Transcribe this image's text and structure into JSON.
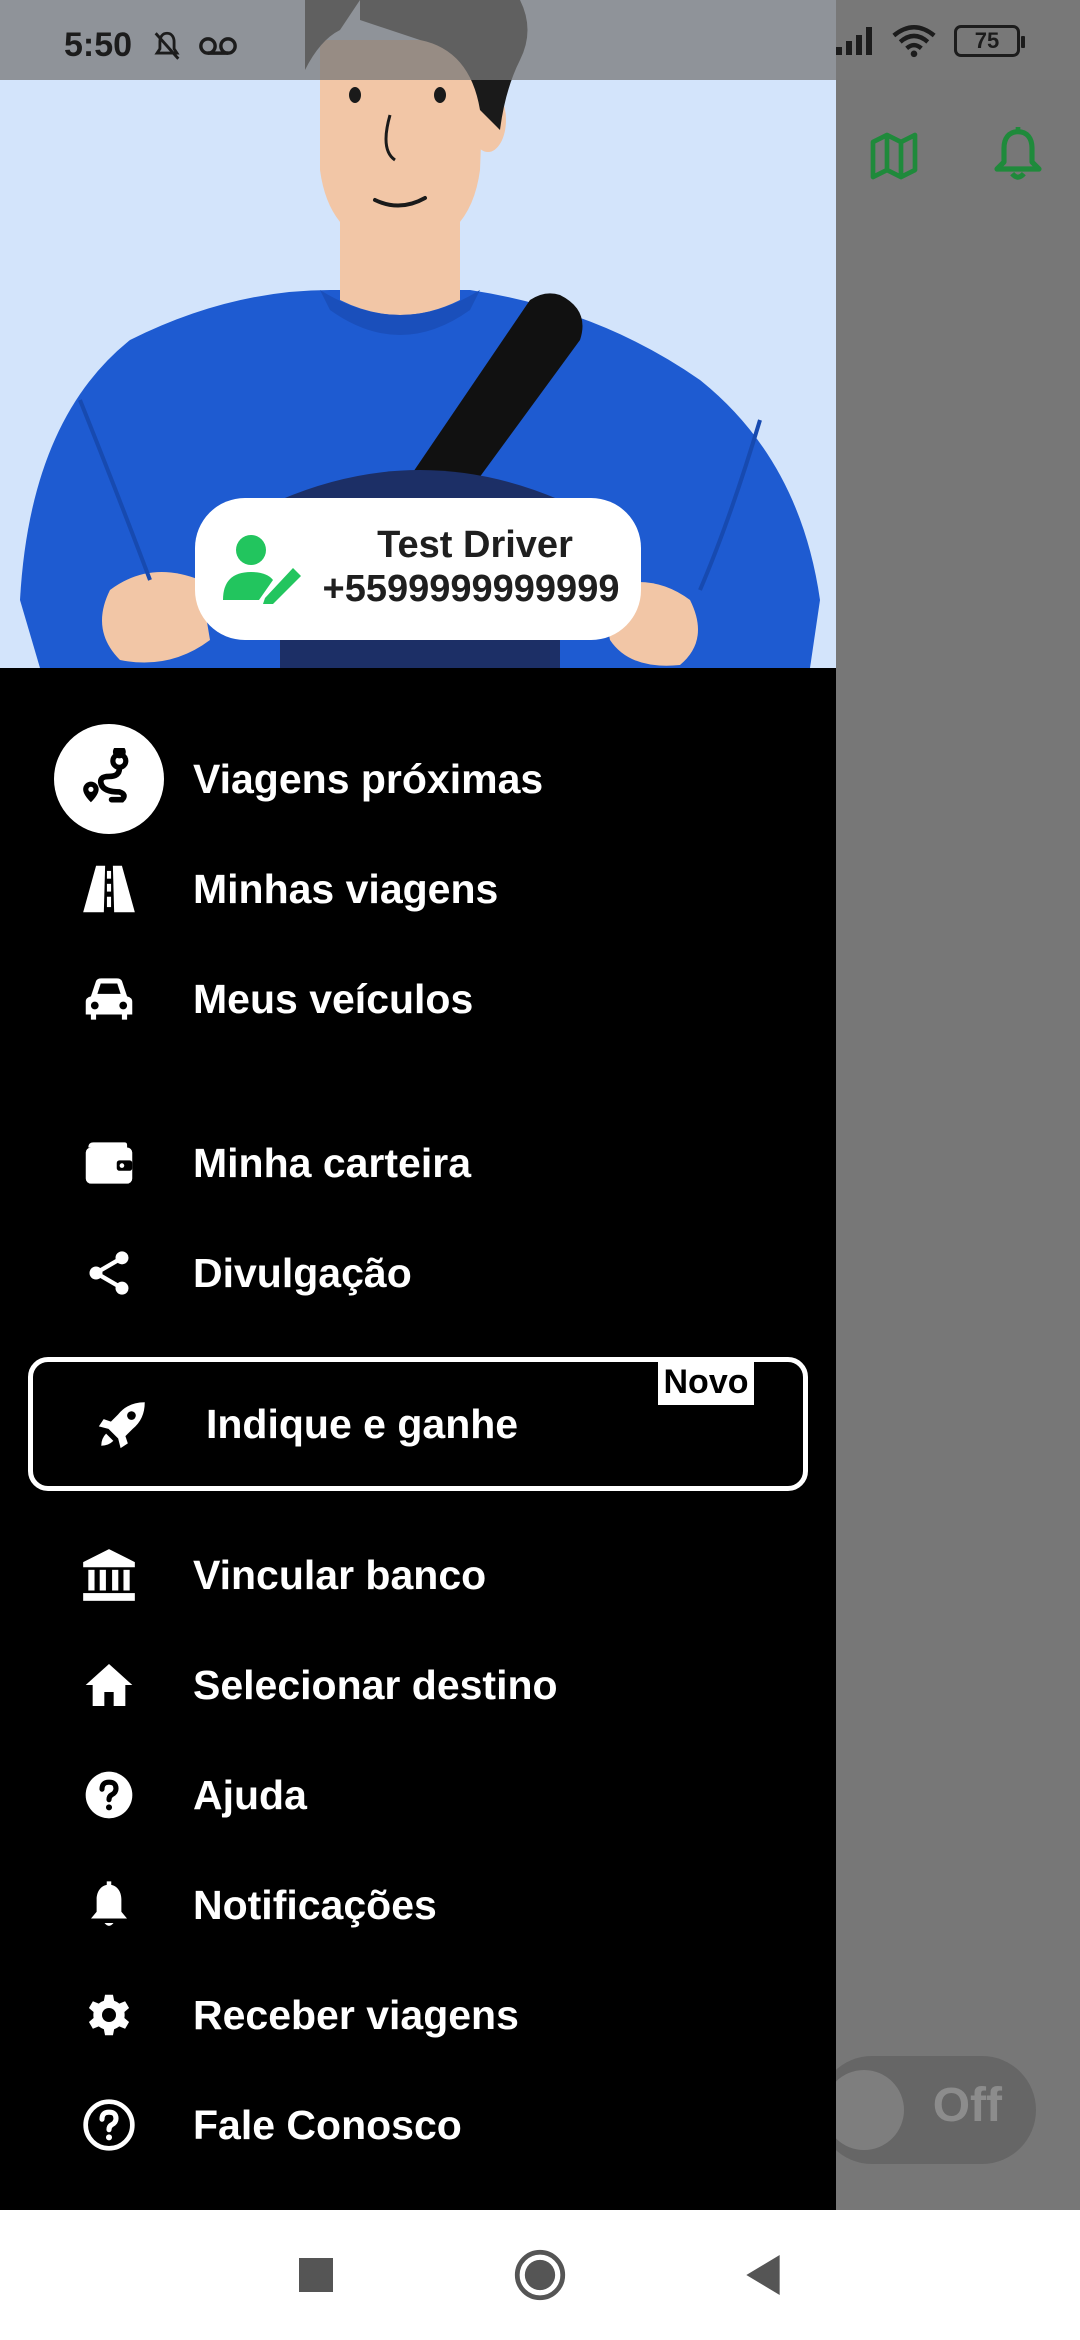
{
  "status_bar": {
    "time": "5:50",
    "left_icons": [
      "mute-icon",
      "voicemail-icon"
    ],
    "right_icons": [
      "signal-icon",
      "wifi-icon"
    ],
    "battery": "75"
  },
  "background": {
    "toggle_label": "Off",
    "icons": [
      "map-icon",
      "bell-icon"
    ],
    "accent_color": "#1f8a3b"
  },
  "profile": {
    "name": "Test Driver",
    "phone": "+5599999999999",
    "icon": "person-edit-icon",
    "icon_color": "#22c55e"
  },
  "menu": {
    "items": [
      {
        "label": "Viagens próximas",
        "icon": "route-icon",
        "active": true
      },
      {
        "label": "Minhas viagens",
        "icon": "road-icon"
      },
      {
        "label": "Meus veículos",
        "icon": "car-icon"
      },
      {
        "label": "Minha carteira",
        "icon": "wallet-icon"
      },
      {
        "label": "Divulgação",
        "icon": "share-icon"
      },
      {
        "label": "Indique e ganhe",
        "icon": "rocket-icon",
        "badge": "Novo"
      },
      {
        "label": "Vincular banco",
        "icon": "bank-icon"
      },
      {
        "label": "Selecionar destino",
        "icon": "home-icon"
      },
      {
        "label": "Ajuda",
        "icon": "help-filled-icon"
      },
      {
        "label": "Notificações",
        "icon": "bell-icon"
      },
      {
        "label": "Receber viagens",
        "icon": "gear-icon"
      },
      {
        "label": "Fale Conosco",
        "icon": "help-outline-icon"
      }
    ]
  },
  "nav_bar": {
    "buttons": [
      "recents-button",
      "home-button",
      "back-button"
    ]
  }
}
